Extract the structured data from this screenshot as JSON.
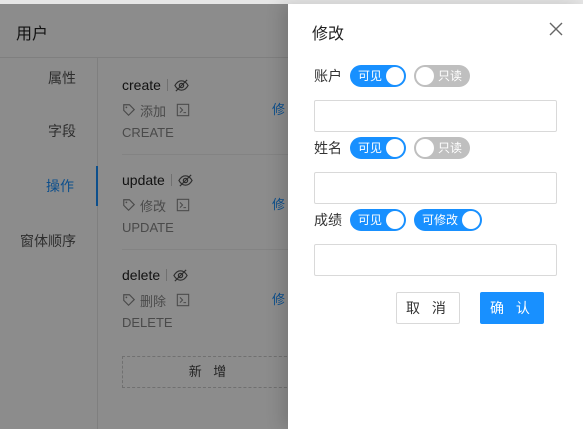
{
  "page": {
    "title": "用户",
    "nav": [
      {
        "label": "属性",
        "active": false
      },
      {
        "label": "字段",
        "active": false
      },
      {
        "label": "操作",
        "active": true
      },
      {
        "label": "窗体顺序",
        "active": false
      }
    ],
    "operations": [
      {
        "name": "create",
        "action": "添加",
        "code": "CREATE",
        "edit_label": "修"
      },
      {
        "name": "update",
        "action": "修改",
        "code": "UPDATE",
        "edit_label": "修"
      },
      {
        "name": "delete",
        "action": "删除",
        "code": "DELETE",
        "edit_label": "修"
      }
    ],
    "add_button": "新 增"
  },
  "drawer": {
    "title": "修改",
    "fields": [
      {
        "label": "账户",
        "switches": [
          {
            "text": "可见",
            "on": true
          },
          {
            "text": "只读",
            "on": false
          }
        ],
        "value": ""
      },
      {
        "label": "姓名",
        "switches": [
          {
            "text": "可见",
            "on": true
          },
          {
            "text": "只读",
            "on": false
          }
        ],
        "value": ""
      },
      {
        "label": "成绩",
        "switches": [
          {
            "text": "可见",
            "on": true
          },
          {
            "text": "可修改",
            "on": true
          }
        ],
        "value": ""
      }
    ],
    "cancel_label": "取 消",
    "ok_label": "确 认"
  },
  "colors": {
    "accent": "#1890ff",
    "switch_off": "#bfbfbf",
    "mask": "rgba(0,0,0,0.45)"
  },
  "icons": {
    "visibility": "eye-off-icon",
    "tag": "tag-icon",
    "code": "terminal-icon",
    "close": "close-icon"
  }
}
